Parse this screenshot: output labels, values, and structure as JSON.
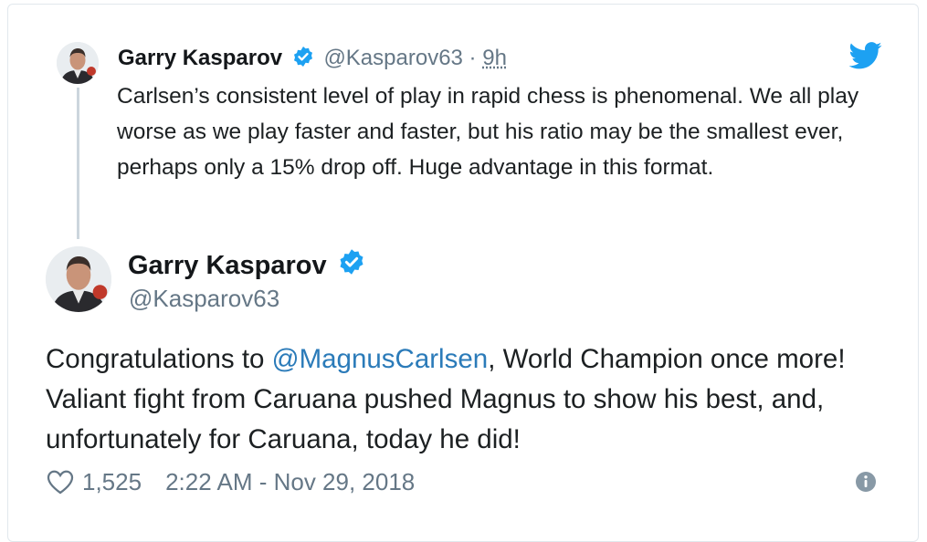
{
  "reply": {
    "name": "Garry Kasparov",
    "handle": "@Kasparov63",
    "separator": " · ",
    "time": "9h",
    "text": "Carlsen’s consistent level of play in rapid chess is phenomenal. We all play worse as we play faster and faster, but his ratio may be the smallest ever, perhaps only a 15% drop off. Huge advantage in this format."
  },
  "tweet": {
    "name": "Garry Kasparov",
    "handle": "@Kasparov63",
    "text_before": "Congratulations to ",
    "mention": "@MagnusCarlsen",
    "text_after": ", World Champion once more! Valiant fight from Caruana pushed Magnus to show his best, and, unfortunately for Caruana, today he did!",
    "likes": "1,525",
    "timestamp": "2:22 AM - Nov 29, 2018"
  },
  "icons": {
    "brand": "twitter-bird-icon",
    "verified": "verified-badge-icon",
    "like": "heart-icon",
    "info": "info-icon"
  },
  "colors": {
    "twitter_blue": "#1da1f2",
    "mention": "#2b7bb9",
    "secondary_text": "#657786",
    "primary_text": "#1c2022"
  }
}
